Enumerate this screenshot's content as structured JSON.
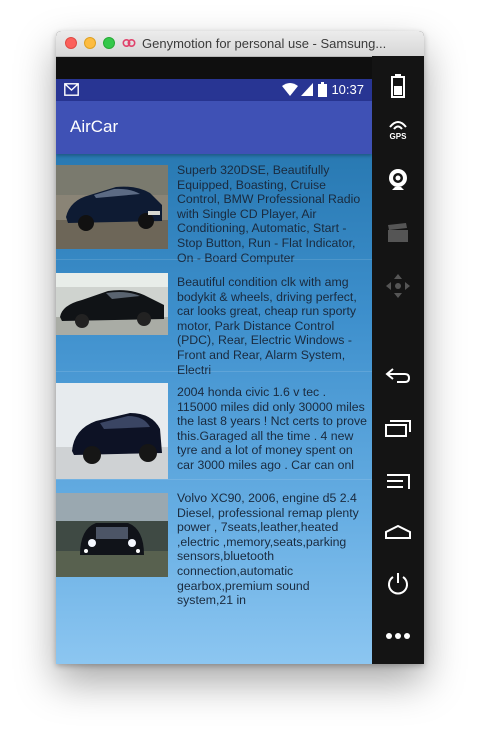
{
  "window": {
    "title": "Genymotion for personal use - Samsung..."
  },
  "statusbar": {
    "time": "10:37"
  },
  "appbar": {
    "title": "AirCar"
  },
  "listings": [
    {
      "description": "Superb 320DSE, Beautifully Equipped, Boasting, Cruise Control, BMW Professional Radio with Single CD Player, Air Conditioning, Automatic, Start - Stop Button, Run - Flat Indicator, On - Board Computer"
    },
    {
      "description": "Beautiful condition clk with amg bodykit & wheels, driving perfect, car looks great, cheap run sporty motor, Park Distance Control (PDC), Rear, Electric Windows - Front and Rear, Alarm System, Electri"
    },
    {
      "description": "2004 honda civic 1.6 v tec . 115000 miles did only 30000 miles the last 8 years ! Nct certs to prove this.Garaged all the time . 4 new tyre and a lot of money spent on car 3000 miles ago . Car can onl"
    },
    {
      "description": "Volvo XC90, 2006, engine d5 2.4 Diesel, professional remap plenty power , 7seats,leather,heated ,electric ,memory,seats,parking sensors,bluetooth connection,automatic gearbox,premium sound system,21 in"
    }
  ],
  "sidebar": {
    "gps_label": "GPS",
    "icons": [
      "battery-icon",
      "gps-icon",
      "camera-icon",
      "clapper-icon",
      "dpad-icon",
      "back-icon",
      "recents-icon",
      "menu-icon",
      "home-icon",
      "power-icon",
      "more-icon"
    ]
  },
  "colors": {
    "status_bar": "#283593",
    "app_bar": "#3f51b5",
    "sidebar": "#141414"
  }
}
